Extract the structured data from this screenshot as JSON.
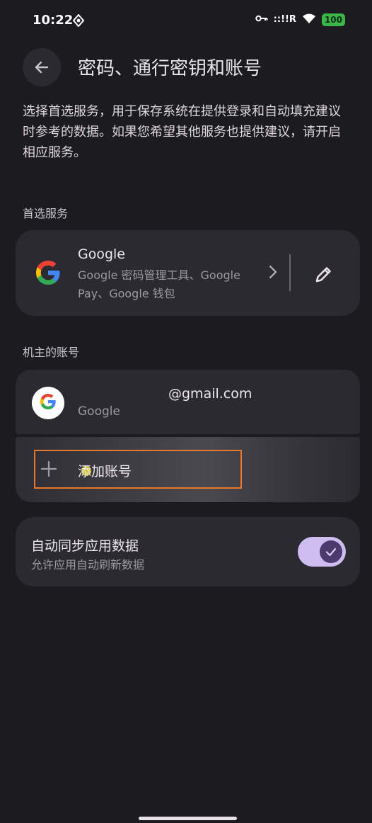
{
  "status_bar": {
    "time": "10:22",
    "signal_text": "::!!R",
    "battery_level": "100"
  },
  "header": {
    "title": "密码、通行密钥和账号"
  },
  "description": "选择首选服务，用于保存系统在提供登录和自动填充建议时参考的数据。如果您希望其他服务也提供建议，请开启相应服务。",
  "preferred_section": {
    "label": "首选服务",
    "service_name": "Google",
    "service_subtitle": "Google 密码管理工具、Google Pay、Google 钱包"
  },
  "owner_section": {
    "label": "机主的账号",
    "account_email": "@gmail.com",
    "account_provider": "Google",
    "add_account_label": "添加账号"
  },
  "sync": {
    "title": "自动同步应用数据",
    "subtitle": "允许应用自动刷新数据",
    "enabled": true
  },
  "colors": {
    "background": "#1c1b20",
    "card": "#2b2a30",
    "toggle_track": "#cdbdf0",
    "toggle_knob": "#4a3b6c",
    "highlight": "#e8772d",
    "battery": "#3bb54a"
  }
}
